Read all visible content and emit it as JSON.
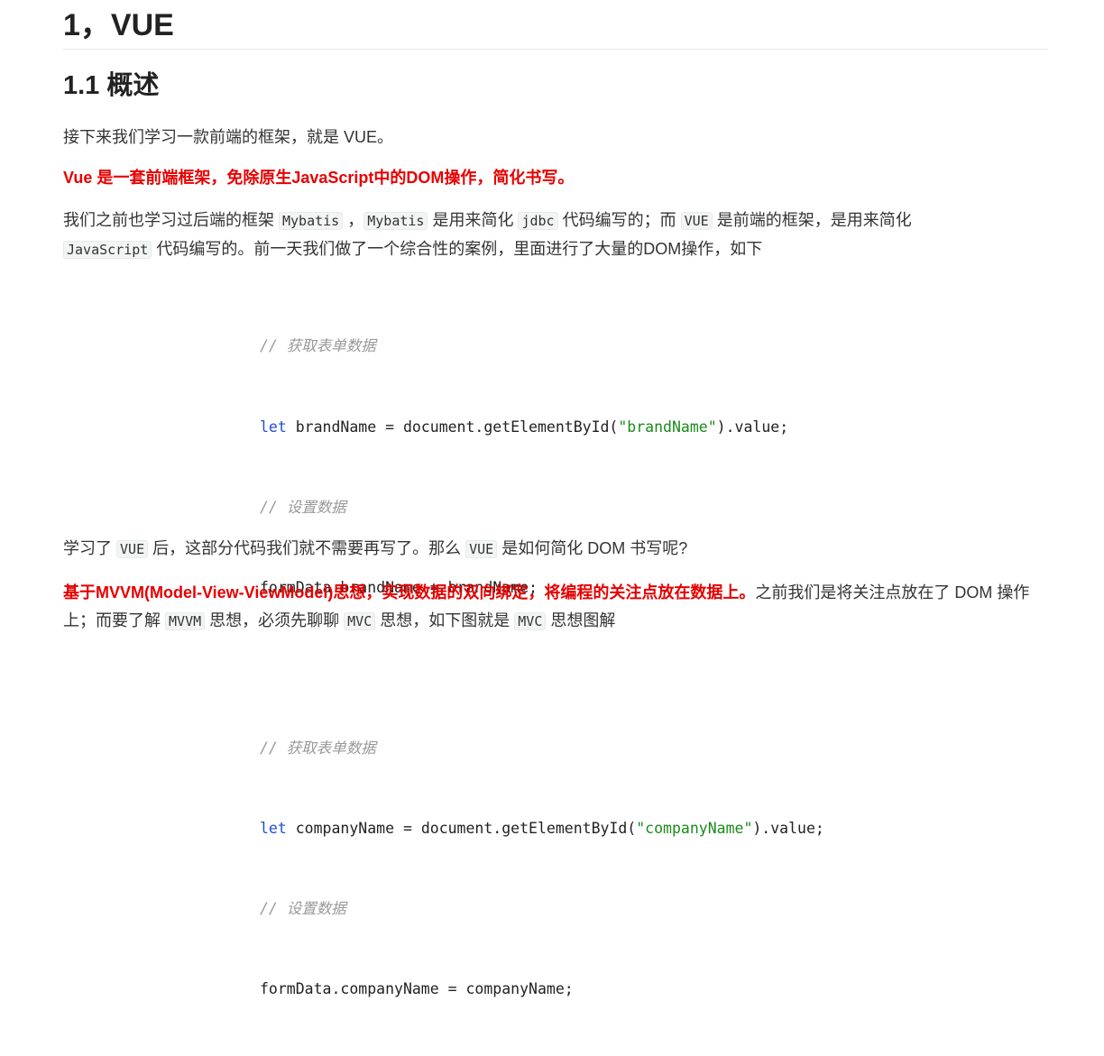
{
  "heading1": "1，VUE",
  "heading2": "1.1 概述",
  "para1": "接下来我们学习一款前端的框架，就是 VUE。",
  "para_red": "Vue 是一套前端框架，免除原生JavaScript中的DOM操作，简化书写。",
  "para2": {
    "t1": "我们之前也学习过后端的框架 ",
    "c1": "Mybatis",
    "t2": " ，",
    "c2": "Mybatis",
    "t3": " 是用来简化 ",
    "c3": "jdbc",
    "t4": " 代码编写的；而 ",
    "c4": "VUE",
    "t5": " 是前端的框架，是用来简化 ",
    "c5": "JavaScript",
    "t6": " 代码编写的。前一天我们做了一个综合性的案例，里面进行了大量的DOM操作，如下"
  },
  "code": {
    "comment1": "// 获取表单数据",
    "kw1": "let",
    "l2a": " brandName = document.getElementById(",
    "str1": "\"brandName\"",
    "l2b": ").value;",
    "comment2": "// 设置数据",
    "l4": "formData.brandName = brandName;",
    "comment3": "// 获取表单数据",
    "kw2": "let",
    "l7a": " companyName = document.getElementById(",
    "str2": "\"companyName\"",
    "l7b": ").value;",
    "comment4": "// 设置数据",
    "l9": "formData.companyName = companyName;"
  },
  "para3": {
    "t1": "学习了 ",
    "c1": "VUE",
    "t2": " 后，这部分代码我们就不需要再写了。那么 ",
    "c2": "VUE",
    "t3": " 是如何简化 DOM 书写呢?"
  },
  "para4": {
    "red": "基于MVVM(Model-View-ViewModel)思想，实现数据的双向绑定，将编程的关注点放在数据上。",
    "t1": "之前我们是将关注点放在了 DOM 操作上；而要了解 ",
    "c1": "MVVM",
    "t2": " 思想，必须先聊聊 ",
    "c2": "MVC",
    "t3": " 思想，如下图就是 ",
    "c3": "MVC",
    "t4": " 思想图解"
  }
}
